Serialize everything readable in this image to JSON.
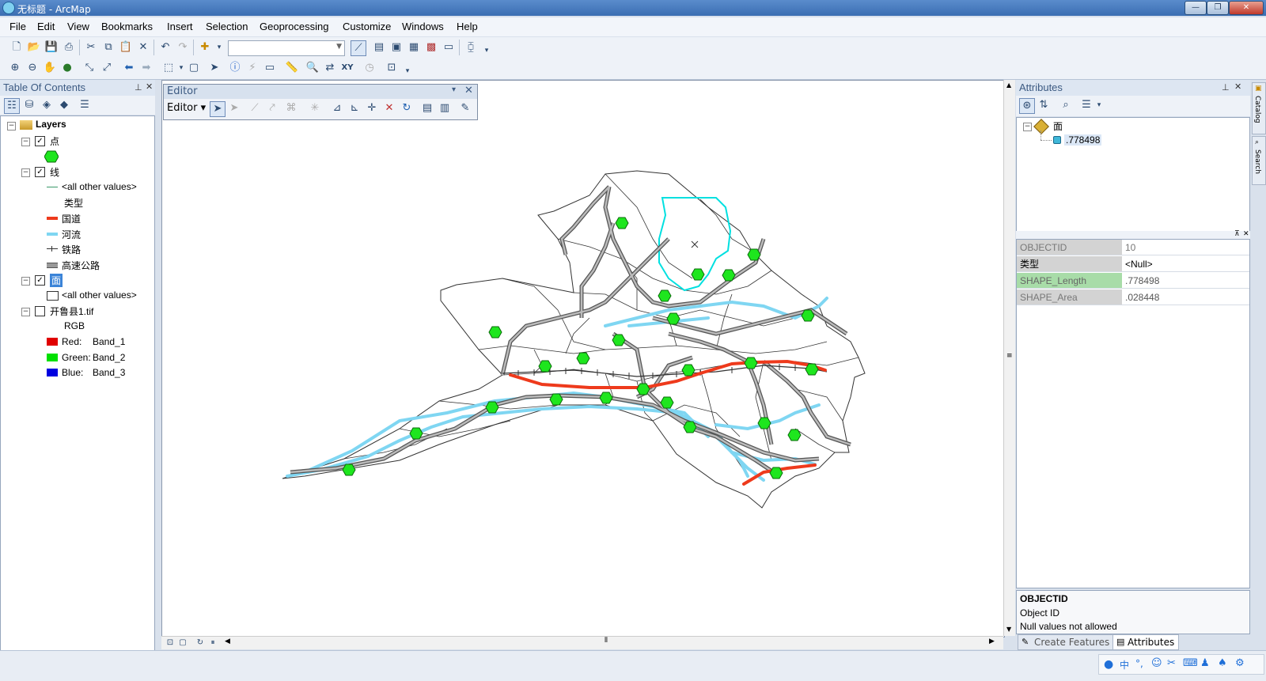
{
  "window": {
    "title": "无标题 - ArcMap"
  },
  "menu": [
    "File",
    "Edit",
    "View",
    "Bookmarks",
    "Insert",
    "Selection",
    "Geoprocessing",
    "Customize",
    "Windows",
    "Help"
  ],
  "toc": {
    "title": "Table Of Contents",
    "root": "Layers",
    "point_layer": "点",
    "line_layer": "线",
    "line_other": "<all other values>",
    "line_field": "类型",
    "line_classes": [
      "国道",
      "河流",
      "铁路",
      "高速公路"
    ],
    "poly_layer": "面",
    "poly_other": "<all other values>",
    "raster_layer": "开鲁县1.tif",
    "raster_type": "RGB",
    "bands": [
      {
        "channel": "Red:",
        "band": "Band_1"
      },
      {
        "channel": "Green:",
        "band": "Band_2"
      },
      {
        "channel": "Blue:",
        "band": "Band_3"
      }
    ]
  },
  "editor": {
    "title": "Editor",
    "menu_label": "Editor"
  },
  "attributes": {
    "title": "Attributes",
    "tree_layer": "面",
    "tree_feature": ".778498",
    "rows": [
      {
        "field": "OBJECTID",
        "value": "10"
      },
      {
        "field": "类型",
        "value": "<Null>"
      },
      {
        "field": "SHAPE_Length",
        "value": ".778498"
      },
      {
        "field": "SHAPE_Area",
        "value": ".028448"
      }
    ],
    "info_title": "OBJECTID",
    "info_line1": "Object ID",
    "info_line2": "Null values not allowed"
  },
  "bottom_tabs": {
    "create_features": "Create Features",
    "attributes": "Attributes"
  },
  "right_tabs": [
    "Catalog",
    "Search"
  ],
  "colors": {
    "guodao": "#ee3a1c",
    "river": "#7fd6f2",
    "point": "#1ee61e",
    "titlebar": "#3b6eb2"
  }
}
